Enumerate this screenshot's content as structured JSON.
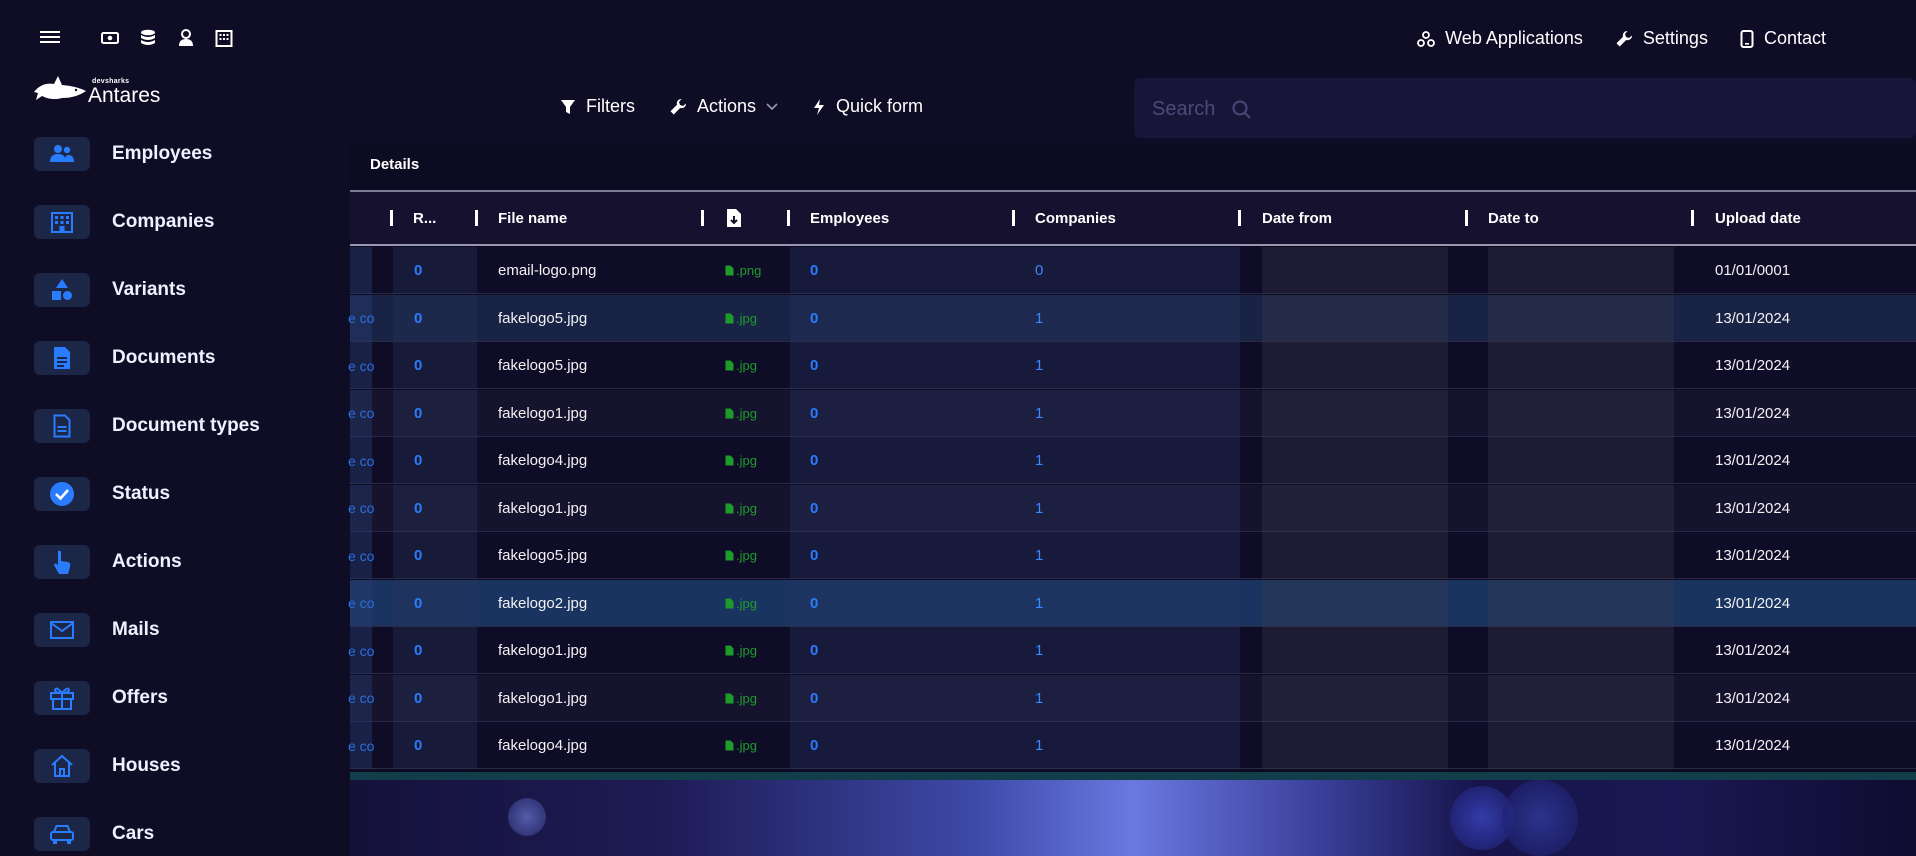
{
  "brand": {
    "small": "devsharks",
    "name": "Antares"
  },
  "topnav": {
    "icons": [
      "money-icon",
      "database-icon",
      "user-icon",
      "building-icon"
    ],
    "links": [
      {
        "label": "Web Applications",
        "icon": "webapps-icon"
      },
      {
        "label": "Settings",
        "icon": "wrench-icon"
      },
      {
        "label": "Contact",
        "icon": "phone-icon"
      }
    ]
  },
  "sidebar": {
    "items": [
      {
        "label": "Employees",
        "icon": "users-icon"
      },
      {
        "label": "Companies",
        "icon": "building-icon"
      },
      {
        "label": "Variants",
        "icon": "shapes-icon"
      },
      {
        "label": "Documents",
        "icon": "document-icon"
      },
      {
        "label": "Document types",
        "icon": "document-outline-icon"
      },
      {
        "label": "Status",
        "icon": "check-circle-icon"
      },
      {
        "label": "Actions",
        "icon": "pointer-icon"
      },
      {
        "label": "Mails",
        "icon": "mail-icon"
      },
      {
        "label": "Offers",
        "icon": "gift-icon"
      },
      {
        "label": "Houses",
        "icon": "house-icon"
      },
      {
        "label": "Cars",
        "icon": "car-icon"
      }
    ]
  },
  "toolbar": {
    "filters": "Filters",
    "actions": "Actions",
    "quick_form": "Quick form",
    "search_placeholder": "Search"
  },
  "tabs": {
    "details": "Details"
  },
  "table": {
    "columns": {
      "r": "R...",
      "file_name": "File name",
      "employees": "Employees",
      "companies": "Companies",
      "date_from": "Date from",
      "date_to": "Date to",
      "upload_date": "Upload date"
    },
    "rows": [
      {
        "cut": "",
        "r": "0",
        "file": "email-logo.png",
        "ext": ".png",
        "emp": "0",
        "comp": "0",
        "upload": "01/01/0001"
      },
      {
        "cut": "e co",
        "r": "0",
        "file": "fakelogo5.jpg",
        "ext": ".jpg",
        "emp": "0",
        "comp": "1",
        "upload": "13/01/2024"
      },
      {
        "cut": "e co",
        "r": "0",
        "file": "fakelogo5.jpg",
        "ext": ".jpg",
        "emp": "0",
        "comp": "1",
        "upload": "13/01/2024"
      },
      {
        "cut": "e co",
        "r": "0",
        "file": "fakelogo1.jpg",
        "ext": ".jpg",
        "emp": "0",
        "comp": "1",
        "upload": "13/01/2024"
      },
      {
        "cut": "e co",
        "r": "0",
        "file": "fakelogo4.jpg",
        "ext": ".jpg",
        "emp": "0",
        "comp": "1",
        "upload": "13/01/2024"
      },
      {
        "cut": "e co",
        "r": "0",
        "file": "fakelogo1.jpg",
        "ext": ".jpg",
        "emp": "0",
        "comp": "1",
        "upload": "13/01/2024"
      },
      {
        "cut": "e co",
        "r": "0",
        "file": "fakelogo5.jpg",
        "ext": ".jpg",
        "emp": "0",
        "comp": "1",
        "upload": "13/01/2024"
      },
      {
        "cut": "e co",
        "r": "0",
        "file": "fakelogo2.jpg",
        "ext": ".jpg",
        "emp": "0",
        "comp": "1",
        "upload": "13/01/2024"
      },
      {
        "cut": "e co",
        "r": "0",
        "file": "fakelogo1.jpg",
        "ext": ".jpg",
        "emp": "0",
        "comp": "1",
        "upload": "13/01/2024"
      },
      {
        "cut": "e co",
        "r": "0",
        "file": "fakelogo1.jpg",
        "ext": ".jpg",
        "emp": "0",
        "comp": "1",
        "upload": "13/01/2024"
      },
      {
        "cut": "e co",
        "r": "0",
        "file": "fakelogo4.jpg",
        "ext": ".jpg",
        "emp": "0",
        "comp": "1",
        "upload": "13/01/2024"
      }
    ]
  },
  "colors": {
    "accent": "#2a7cff",
    "background": "#0f0c26",
    "green": "#1e9c2a"
  }
}
